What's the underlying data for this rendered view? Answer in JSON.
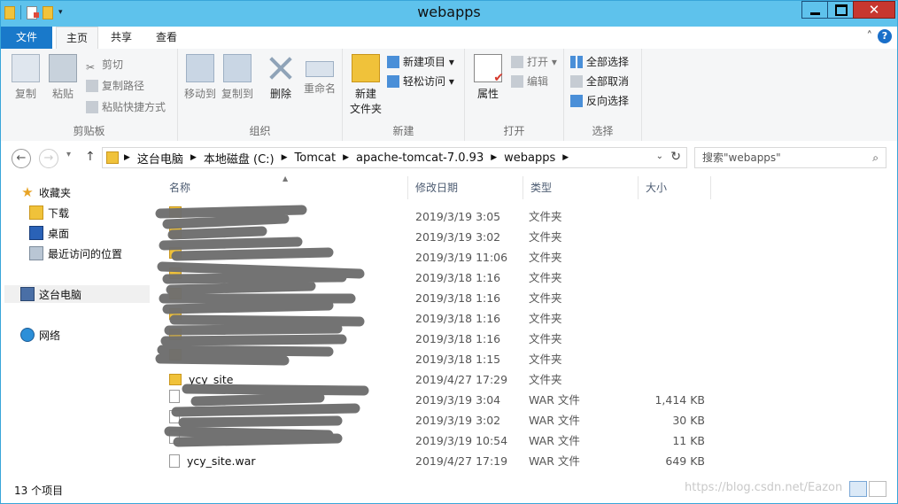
{
  "window": {
    "title": "webapps"
  },
  "tabs": [
    {
      "label": "文件"
    },
    {
      "label": "主页"
    },
    {
      "label": "共享"
    },
    {
      "label": "查看"
    }
  ],
  "ribbon": {
    "clipboard": {
      "copy": "复制",
      "paste": "粘贴",
      "cut": "剪切",
      "copy_path": "复制路径",
      "paste_shortcut": "粘贴快捷方式",
      "group_label": "剪贴板"
    },
    "organize": {
      "move_to": "移动到",
      "copy_to": "复制到",
      "delete": "删除",
      "rename": "重命名",
      "group_label": "组织"
    },
    "new": {
      "new_folder_line1": "新建",
      "new_folder_line2": "文件夹",
      "new_item": "新建项目",
      "easy_access": "轻松访问",
      "group_label": "新建"
    },
    "open": {
      "properties": "属性",
      "open": "打开",
      "edit": "编辑",
      "group_label": "打开"
    },
    "select": {
      "select_all": "全部选择",
      "select_none": "全部取消",
      "invert": "反向选择",
      "group_label": "选择"
    }
  },
  "address": {
    "crumbs": [
      "这台电脑",
      "本地磁盘 (C:)",
      "Tomcat",
      "apache-tomcat-7.0.93",
      "webapps"
    ]
  },
  "search": {
    "placeholder": "搜索\"webapps\""
  },
  "nav_pane": {
    "favorites": "收藏夹",
    "downloads": "下载",
    "desktop": "桌面",
    "recent": "最近访问的位置",
    "this_pc": "这台电脑",
    "network": "网络"
  },
  "columns": {
    "name": "名称",
    "date": "修改日期",
    "type": "类型",
    "size": "大小"
  },
  "files": [
    {
      "name": "",
      "date": "2019/3/19 3:05",
      "type": "文件夹",
      "size": "",
      "kind": "folder"
    },
    {
      "name": "",
      "date": "2019/3/19 3:02",
      "type": "文件夹",
      "size": "",
      "kind": "folder"
    },
    {
      "name": "",
      "date": "2019/3/19 11:06",
      "type": "文件夹",
      "size": "",
      "kind": "folder"
    },
    {
      "name": "",
      "date": "2019/3/18 1:16",
      "type": "文件夹",
      "size": "",
      "kind": "folder"
    },
    {
      "name": "",
      "date": "2019/3/18 1:16",
      "type": "文件夹",
      "size": "",
      "kind": "folder"
    },
    {
      "name": "",
      "date": "2019/3/18 1:16",
      "type": "文件夹",
      "size": "",
      "kind": "folder"
    },
    {
      "name": "",
      "date": "2019/3/18 1:16",
      "type": "文件夹",
      "size": "",
      "kind": "folder"
    },
    {
      "name": "",
      "date": "2019/3/18 1:15",
      "type": "文件夹",
      "size": "",
      "kind": "folder"
    },
    {
      "name": "ycy_site",
      "date": "2019/4/27 17:29",
      "type": "文件夹",
      "size": "",
      "kind": "folder"
    },
    {
      "name": "",
      "date": "2019/3/19 3:04",
      "type": "WAR 文件",
      "size": "1,414 KB",
      "kind": "war"
    },
    {
      "name": "",
      "date": "2019/3/19 3:02",
      "type": "WAR 文件",
      "size": "30 KB",
      "kind": "war"
    },
    {
      "name": "",
      "date": "2019/3/19 10:54",
      "type": "WAR 文件",
      "size": "11 KB",
      "kind": "war"
    },
    {
      "name": "ycy_site.war",
      "date": "2019/4/27 17:19",
      "type": "WAR 文件",
      "size": "649 KB",
      "kind": "war"
    }
  ],
  "status": {
    "count": "13 个项目",
    "watermark": "https://blog.csdn.net/Eazon"
  }
}
